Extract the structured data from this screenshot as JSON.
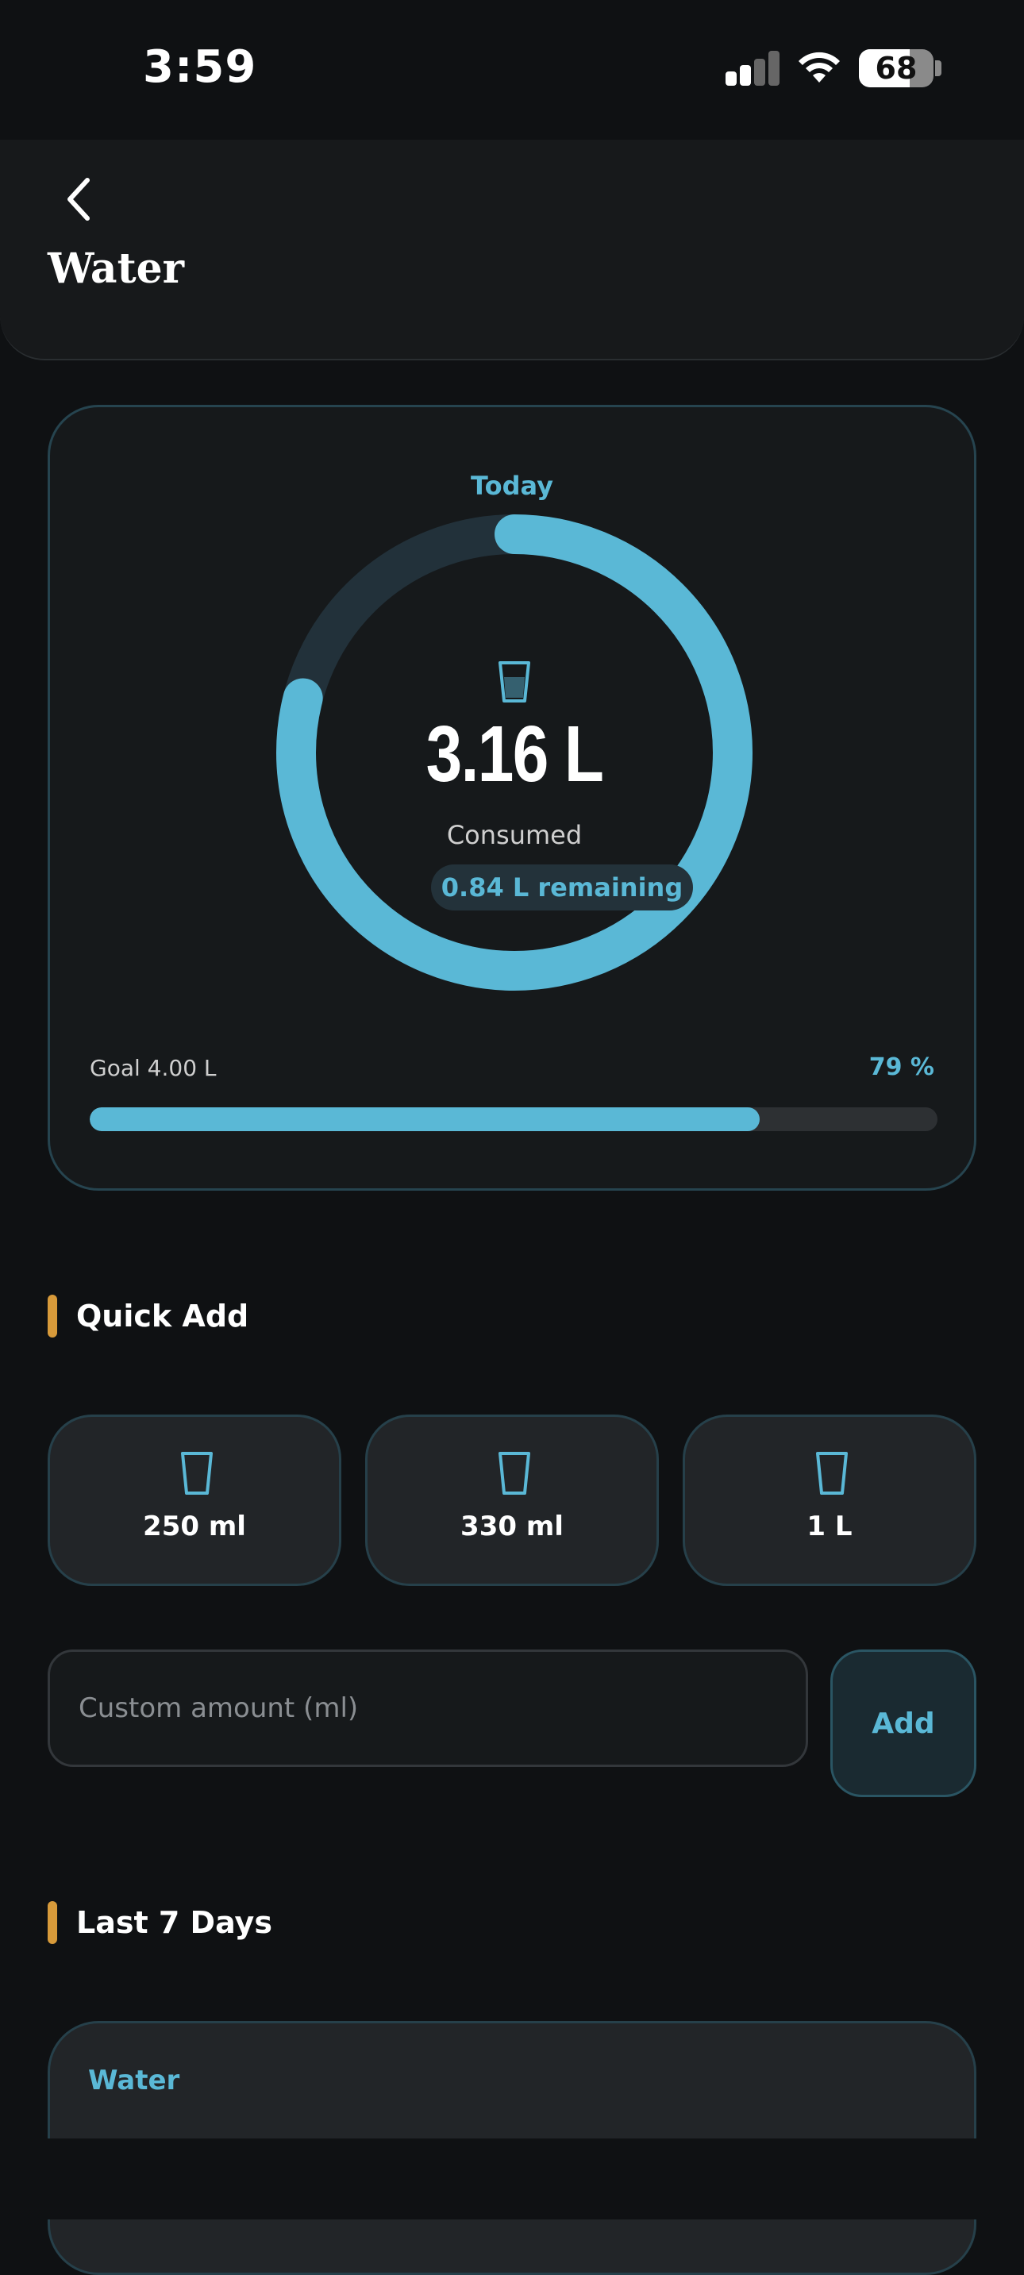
{
  "status_bar": {
    "time": "3:59",
    "battery": "68",
    "battery_level": 0.68,
    "signal_bars_active": 2,
    "signal_bars_total": 4
  },
  "header": {
    "back_icon": "chevron-left-icon",
    "title": "Water"
  },
  "today": {
    "label": "Today",
    "icon": "glass-icon",
    "consumed_value": "3.16 L",
    "consumed_label": "Consumed",
    "remaining": "0.84 L remaining",
    "goal_label": "Goal 4.00 L",
    "percent_label": "79 %",
    "progress": 0.79
  },
  "quick_add": {
    "title": "Quick Add",
    "buttons": [
      {
        "label": "250 ml",
        "icon": "glass-icon"
      },
      {
        "label": "330 ml",
        "icon": "glass-icon"
      },
      {
        "label": "1 L",
        "icon": "glass-icon"
      }
    ]
  },
  "custom": {
    "placeholder": "Custom amount (ml)",
    "value": "",
    "add_label": "Add"
  },
  "last_7_days": {
    "title": "Last 7 Days",
    "card_title": "Water"
  },
  "colors": {
    "accent": "#5ab8d6",
    "section_accent": "#d79a3a",
    "background": "#0f1113",
    "card": "#16191b",
    "ring_track": "#22313a"
  }
}
